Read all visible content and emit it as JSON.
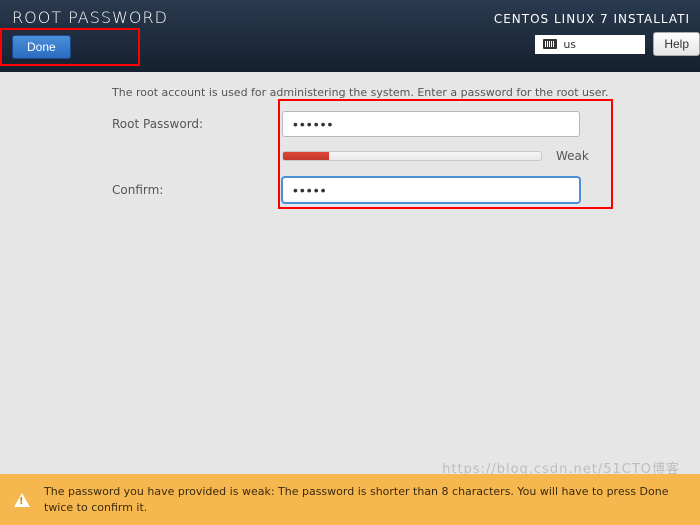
{
  "header": {
    "title": "ROOT PASSWORD",
    "install_title": "CENTOS LINUX 7 INSTALLATI",
    "done_label": "Done",
    "help_label": "Help",
    "keyboard_layout": "us"
  },
  "content": {
    "instruction": "The root account is used for administering the system.  Enter a password for the root user.",
    "root_password_label": "Root Password:",
    "root_password_value": "••••••",
    "confirm_label": "Confirm:",
    "confirm_value": "•••••",
    "strength_label": "Weak",
    "strength_percent": "18%"
  },
  "warning": {
    "text": "The password you have provided is weak: The password is shorter than 8 characters. You will have to press Done twice to confirm it."
  },
  "watermark": "https://blog.csdn.net/51CTO博客",
  "colors": {
    "header_bg": "#1c2a3b",
    "accent": "#3b7dc4",
    "warn_bg": "#f6b84e",
    "weak_fill": "#c0392b",
    "highlight_border": "#ff0000"
  }
}
